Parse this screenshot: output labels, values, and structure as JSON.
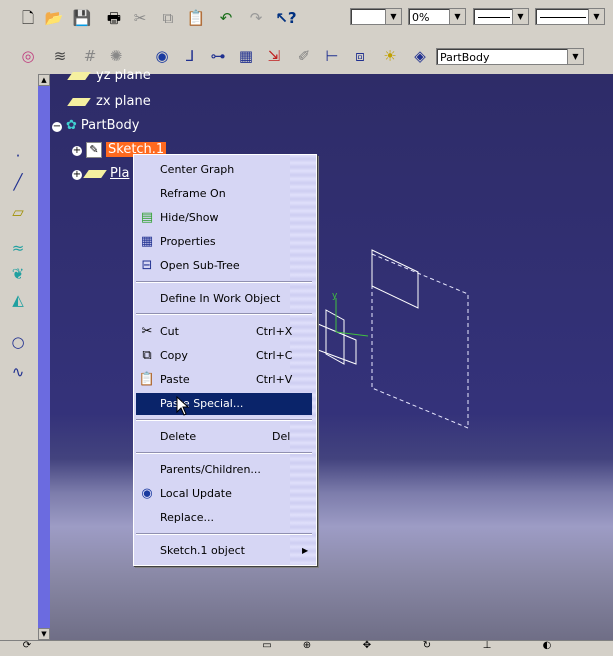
{
  "toolbar": {
    "row1_icons": [
      "new-icon",
      "open-icon",
      "save-icon",
      "print-icon",
      "cut-icon",
      "copy-icon",
      "paste-icon",
      "undo-icon",
      "redo-icon",
      "whats-this-icon"
    ],
    "color_combo": "",
    "transparency_combo": "0%",
    "line_type_combo": "",
    "line_weight_combo": "",
    "row2_icons": [
      "analysis-icon",
      "snap-icon",
      "grid-icon",
      "point-icon",
      "update-icon",
      "axis-icon",
      "constraint-icon",
      "grid-toggle-icon",
      "cut-part-icon",
      "sketch-tools-icon",
      "tree-icon",
      "catalog-icon",
      "lights-icon",
      "material-icon"
    ],
    "part_combo": "PartBody"
  },
  "tree": {
    "yz_plane": "yz plane",
    "zx_plane": "zx plane",
    "partbody": "PartBody",
    "sketch": "Sketch.1",
    "plane_partial": "Pla"
  },
  "menu": {
    "items": [
      {
        "label": "Center Graph",
        "shortcut": "",
        "icon": ""
      },
      {
        "label": "Reframe On",
        "shortcut": "",
        "icon": ""
      },
      {
        "label": "Hide/Show",
        "shortcut": "",
        "icon": "hide-show-icon"
      },
      {
        "label": "Properties",
        "shortcut": "",
        "icon": "properties-icon"
      },
      {
        "label": "Open Sub-Tree",
        "shortcut": "",
        "icon": "subtree-icon"
      },
      {
        "label": "Define In Work Object",
        "shortcut": "",
        "icon": ""
      },
      {
        "label": "Cut",
        "shortcut": "Ctrl+X",
        "icon": "scissors-icon"
      },
      {
        "label": "Copy",
        "shortcut": "Ctrl+C",
        "icon": "copy-icon"
      },
      {
        "label": "Paste",
        "shortcut": "Ctrl+V",
        "icon": "paste-icon"
      },
      {
        "label": "Paste Special...",
        "shortcut": "",
        "icon": ""
      },
      {
        "label": "Delete",
        "shortcut": "Del",
        "icon": ""
      },
      {
        "label": "Parents/Children...",
        "shortcut": "",
        "icon": ""
      },
      {
        "label": "Local Update",
        "shortcut": "",
        "icon": "local-update-icon"
      },
      {
        "label": "Replace...",
        "shortcut": "",
        "icon": ""
      },
      {
        "label": "Sketch.1 object",
        "shortcut": "",
        "icon": ""
      }
    ],
    "highlighted_index": 9
  },
  "colors": {
    "viewport_top": "#2e2c68",
    "highlight": "#0a246a",
    "selection": "#ff6a1f",
    "scroll_track": "#6b6be0"
  }
}
